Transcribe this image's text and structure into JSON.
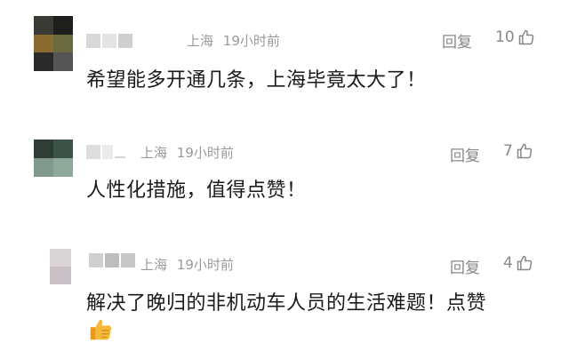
{
  "comments": [
    {
      "location": "上海",
      "time": "19小时前",
      "reply_label": "回复",
      "like_count": "10",
      "text": "希望能多开通几条，上海毕竟太大了！",
      "avatar_colors": [
        "#3a3a35",
        "#1e1e1c",
        "#8a6a2e",
        "#6a6a40",
        "#2a2a2a",
        "#555555"
      ]
    },
    {
      "location": "上海",
      "time": "19小时前",
      "reply_label": "回复",
      "like_count": "7",
      "text": "人性化措施，值得点赞！",
      "avatar_colors": [
        "#2f3d36",
        "#3c5248",
        "#7f9a8c",
        "#8ea89a",
        "#ffffff",
        "#ffffff"
      ]
    },
    {
      "location": "上海",
      "time": "19小时前",
      "reply_label": "回复",
      "like_count": "4",
      "text": "解决了晚归的非机动车人员的生活难题！点赞",
      "avatar_colors": [
        "#f2f2f2",
        "#d9d4d6",
        "#e6e2e4",
        "#c9c1c5",
        "#f0eeef",
        "#dcd7d9"
      ],
      "emoji": "thumbs-up"
    }
  ],
  "colors": {
    "text": "#1a1a1a",
    "meta": "#9a9a9a",
    "action": "#888888",
    "emoji": "#f2b233"
  }
}
